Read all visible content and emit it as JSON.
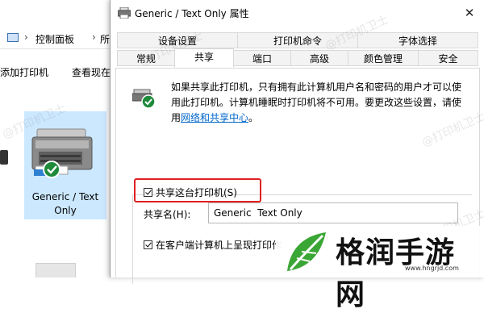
{
  "explorer": {
    "breadcrumbs": [
      "控制面板",
      "所"
    ],
    "toolbar": {
      "add_printer": "添加打印机",
      "view_now": "查看现在"
    },
    "selected_printer": {
      "name_line1": "Generic / Text",
      "name_line2": "Only",
      "status_icon": "check-icon"
    }
  },
  "dialog": {
    "title": "Generic / Text Only 属性",
    "close_glyph": "✕",
    "tabs_row1": [
      "设备设置",
      "打印机命令",
      "字体选择"
    ],
    "tabs_row2": [
      "常规",
      "共享",
      "端口",
      "高级",
      "颜色管理",
      "安全"
    ],
    "active_tab": "共享",
    "share_info": {
      "text_line1": "如果共享此打印机，只有拥有此计算机用户名和密码的用户才可以使",
      "text_line2": "用此打印机。计算机睡眠时打印机将不可用。要更改这些设置，请使",
      "text_line3_prefix": "用",
      "link": "网络和共享中心",
      "text_line3_suffix": "。"
    },
    "share_checkbox": {
      "label": "共享这台打印机(S)",
      "checked": true
    },
    "share_name": {
      "label": "共享名(H):",
      "value": "Generic  Text Only"
    },
    "render_checkbox": {
      "label": "在客户端计算机上呈现打印作",
      "checked": true
    }
  },
  "watermark": "@打印机卫士",
  "logo": {
    "text": "格润手游网",
    "url": "www.hngrjd.com"
  },
  "colors": {
    "highlight": "#e02020",
    "selection": "#cce8ff",
    "link": "#0066cc"
  }
}
